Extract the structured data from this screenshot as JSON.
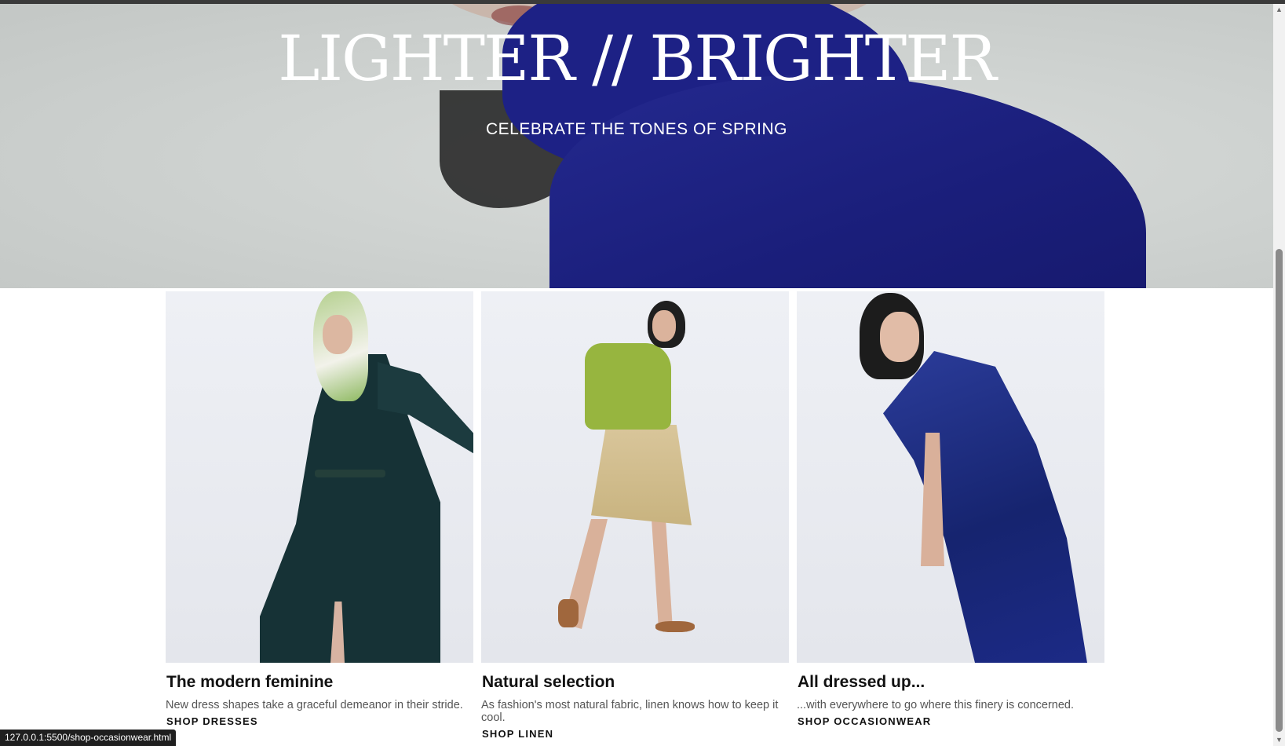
{
  "hero": {
    "title": "LIGHTER // BRIGHTER",
    "subtitle": "CELEBRATE THE TONES OF SPRING"
  },
  "cards": [
    {
      "title": "The modern feminine",
      "description": "New dress shapes take a graceful demeanor in their stride.",
      "cta": "SHOP DRESSES"
    },
    {
      "title": "Natural selection",
      "description": "As fashion's most natural fabric, linen knows how to keep it cool.",
      "cta": "SHOP LINEN"
    },
    {
      "title": "All dressed up...",
      "description": "...with everywhere to go where this finery is concerned.",
      "cta": "SHOP OCCASIONWEAR"
    }
  ],
  "status_url": "127.0.0.1:5500/shop-occasionwear.html",
  "icons": {
    "scroll_up": "scroll-up-arrow-icon",
    "scroll_down": "scroll-down-arrow-icon"
  },
  "colors": {
    "hero_blue": "#1d2185",
    "text_dark": "#111111",
    "text_muted": "#555555"
  }
}
